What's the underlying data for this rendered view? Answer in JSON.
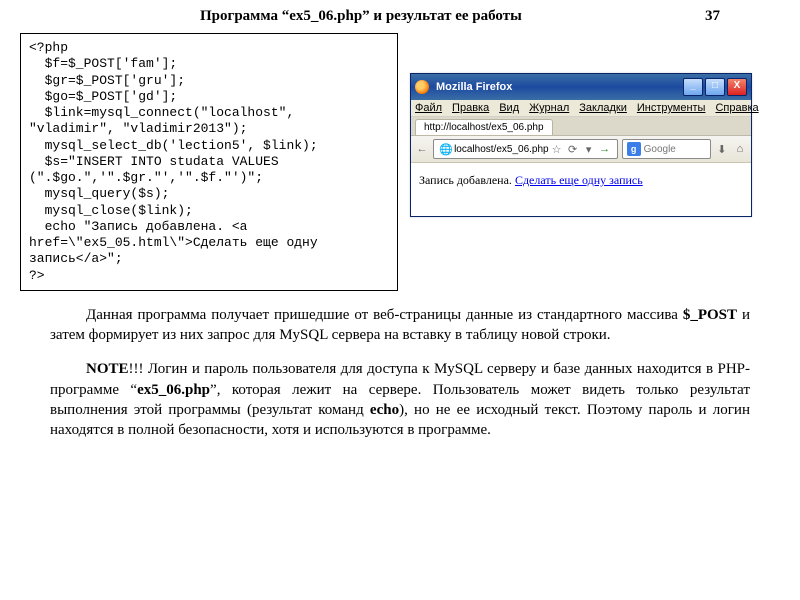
{
  "header": {
    "title": "Программа “ex5_06.php” и  результат  ее  работы",
    "page_number": "37"
  },
  "code": {
    "lines": [
      "<?php",
      "  $f=$_POST['fam'];",
      "  $gr=$_POST['gru'];",
      "  $go=$_POST['gd'];",
      "  $link=mysql_connect(\"localhost\",",
      "\"vladimir\", \"vladimir2013\");",
      "  mysql_select_db('lection5', $link);",
      "  $s=\"INSERT INTO studata VALUES",
      "(\".$go.\",'\".$gr.\"','\".$f.\"')\";",
      "  mysql_query($s);",
      "  mysql_close($link);",
      "  echo \"Запись добавлена. <a",
      "href=\\\"ex5_05.html\\\">Сделать еще одну",
      "запись</a>\";",
      "?>"
    ]
  },
  "browser": {
    "title": "Mozilla Firefox",
    "menu": [
      "Файл",
      "Правка",
      "Вид",
      "Журнал",
      "Закладки",
      "Инструменты",
      "Справка"
    ],
    "tab_label": "http://localhost/ex5_06.php",
    "url": "localhost/ex5_06.php",
    "search_placeholder": "Google",
    "content_text": "Запись добавлена. ",
    "content_link": "Сделать еще одну запись",
    "buttons": {
      "min": "_",
      "max": "□",
      "close": "X"
    },
    "nav": {
      "back": "←",
      "reload": "⟳",
      "home": "⌂",
      "star": "☆",
      "dropdown": "▾",
      "go": "→",
      "down": "⬇"
    }
  },
  "paragraphs": {
    "p1_a": "Данная  программа  получает  пришедшие  от  веб-страницы  данные  из стандартного  массива ",
    "p1_b": "$_POST",
    "p1_c": " и  затем формирует  из   них   запрос   для MySQL сервера  на  вставку  в  таблицу новой строки.",
    "p2_a": "NOTE",
    "p2_b": "!!! Логин  и  пароль  пользователя для  доступа  к MySQL серверу  и  базе данных   находится  в  PHP-программе  “",
    "p2_c": "ex5_06.php",
    "p2_d": "”,  которая  лежит  на  сервере. Пользователь  может  видеть  только  результат  выполнения этой  программы (результат  команд ",
    "p2_e": "echo",
    "p2_f": "),  но  не  ее исходный  текст.  Поэтому  пароль  и  логин  находятся  в полной безопасности, хотя и используются в программе."
  }
}
